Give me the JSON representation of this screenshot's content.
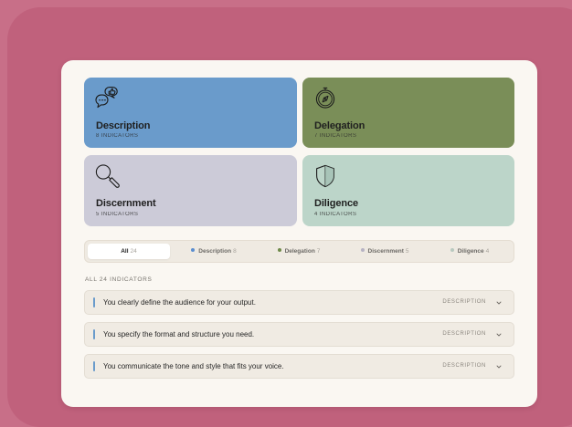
{
  "colors": {
    "background": "#c86f88",
    "frame": "#c0617c",
    "description": "#6a9bcb",
    "delegation": "#7a8e58",
    "discernment": "#cccbd8",
    "diligence": "#bcd5c9"
  },
  "cards": [
    {
      "title": "Description",
      "subtitle": "8 INDICATORS",
      "icon": "speech-bubbles-thumbs-up-icon"
    },
    {
      "title": "Delegation",
      "subtitle": "7 INDICATORS",
      "icon": "compass-icon"
    },
    {
      "title": "Discernment",
      "subtitle": "5 INDICATORS",
      "icon": "magnifier-icon"
    },
    {
      "title": "Diligence",
      "subtitle": "4 INDICATORS",
      "icon": "shield-icon"
    }
  ],
  "tabs": [
    {
      "label": "All",
      "count": "24",
      "active": true
    },
    {
      "label": "Description",
      "count": "8",
      "dot": "#5b8ed0"
    },
    {
      "label": "Delegation",
      "count": "7",
      "dot": "#6f8a4a"
    },
    {
      "label": "Discernment",
      "count": "5",
      "dot": "#b7b3c4"
    },
    {
      "label": "Diligence",
      "count": "4",
      "dot": "#b9c9c0"
    }
  ],
  "section_heading": "ALL 24 INDICATORS",
  "indicators": [
    {
      "text": "You clearly define the audience for your output.",
      "category": "DESCRIPTION"
    },
    {
      "text": "You specify the format and structure you need.",
      "category": "DESCRIPTION"
    },
    {
      "text": "You communicate the tone and style that fits your voice.",
      "category": "DESCRIPTION"
    }
  ]
}
